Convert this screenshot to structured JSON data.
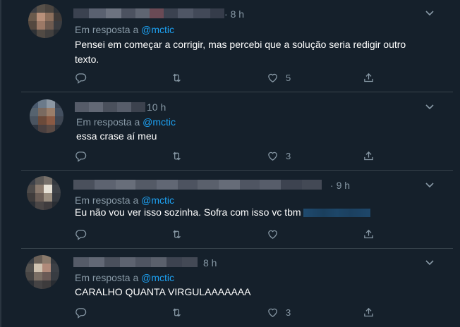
{
  "tweets": [
    {
      "time": "8 h",
      "reply_prefix": "Em resposta a",
      "reply_handle": "@mctic",
      "text": "Pensei em começar a corrigir, mas percebi que a solução seria redigir outro texto.",
      "like_count": "5"
    },
    {
      "time": "10 h",
      "reply_prefix": "Em resposta a",
      "reply_handle": "@mctic",
      "text": "essa crase aí meu",
      "like_count": "3"
    },
    {
      "time": "9 h",
      "reply_prefix": "Em resposta a",
      "reply_handle": "@mctic",
      "text": "Eu não vou ver isso sozinha. Sofra com isso vc tbm",
      "like_count": ""
    },
    {
      "time": "8 h",
      "reply_prefix": "Em resposta a",
      "reply_handle": "@mctic",
      "text": "CARALHO QUANTA VIRGULAAAAAAA",
      "like_count": "3"
    }
  ],
  "icons": {
    "reply": "reply-icon",
    "retweet": "retweet-icon",
    "like": "heart-icon",
    "share": "share-icon",
    "menu": "chevron-down-icon"
  },
  "colors": {
    "background": "#15202b",
    "divider": "#38444d",
    "secondary_text": "#8899a6",
    "link": "#1da1f2"
  }
}
